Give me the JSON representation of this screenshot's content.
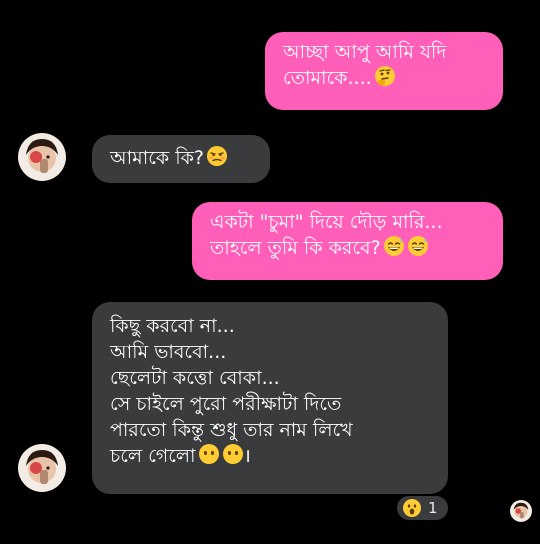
{
  "messages": [
    {
      "direction": "outgoing",
      "lines": [
        "আচ্ছা আপু আমি যদি",
        "তোমাকে...."
      ],
      "trailing_emoji": "thinking-face"
    },
    {
      "direction": "incoming",
      "lines": [
        "আমাকে কি?"
      ],
      "trailing_emoji": "unamused-face"
    },
    {
      "direction": "outgoing",
      "lines": [
        "একটা \"চুমা\" দিয়ে দৌড় মারি...",
        "তাহলে তুমি কি করবে?"
      ],
      "trailing_emoji": "grinning-sweat-face"
    },
    {
      "direction": "incoming",
      "lines": [
        "কিছু করবো না...",
        "আমি ভাববো...",
        "ছেলেটা কত্তো বোকা...",
        "সে চাইলে পুরো পরীক্ষাটা দিতে",
        "পারতো কিন্তু শুধু তার নাম লিখে",
        "চলে গেলো"
      ],
      "trailing_text": "।",
      "trailing_emoji": "face-without-mouth"
    }
  ],
  "reaction": {
    "emoji": "open-mouth-face",
    "count": "1"
  },
  "colors": {
    "background": "#000000",
    "outgoing_bubble": "#ff5fb8",
    "incoming_bubble": "#3a3b3c",
    "text": "#ffffff"
  }
}
